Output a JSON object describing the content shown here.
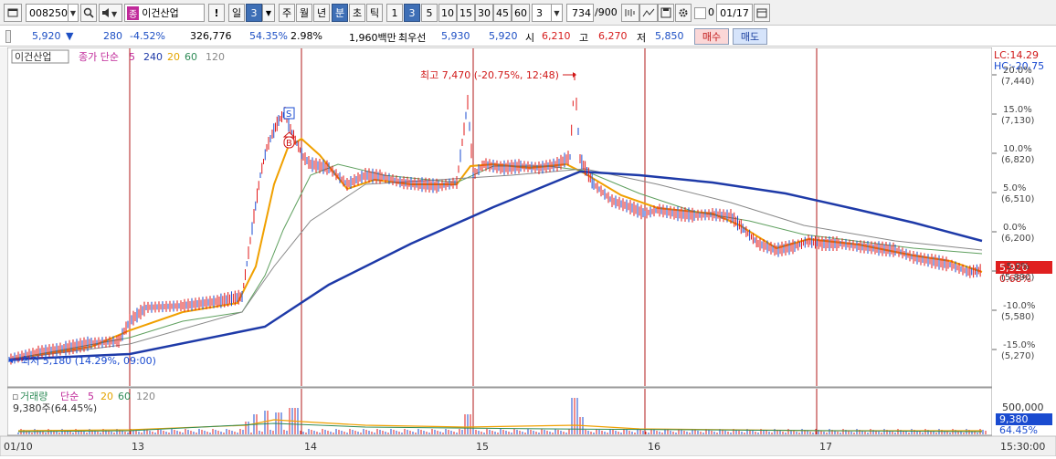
{
  "toolbar": {
    "code": "008250",
    "stock_badge": "종",
    "stock_name": "이건산업",
    "alert_label": "!",
    "period_daily": "일",
    "period_daily_value": "3",
    "period_weekly": "주",
    "period_monthly": "월",
    "period_yearly": "년",
    "period_minute": "분",
    "period_second": "초",
    "period_tick": "틱",
    "intervals": [
      "1",
      "3",
      "5",
      "10",
      "15",
      "30",
      "45",
      "60"
    ],
    "interval_active": "3",
    "interval_select": "3",
    "count_value": "734",
    "count_total": "/900",
    "zero_label": "0",
    "date_value": "01/17"
  },
  "quote": {
    "price": "5,920",
    "change": "280",
    "change_pct": "-4.52%",
    "volume": "326,776",
    "volume_ratio": "54.35%",
    "turnover_pct": "2.98%",
    "amount": "1,960백만",
    "best_ask_label": "최우선",
    "best_ask": "5,930",
    "best_bid": "5,920",
    "open_label": "시",
    "open": "6,210",
    "high_label": "고",
    "high": "6,270",
    "low_label": "저",
    "low": "5,850",
    "buy_label": "매수",
    "sell_label": "매도"
  },
  "price_panel": {
    "legend_name": "이건산업",
    "legend_indicator": "종가 단순",
    "ma_periods": [
      "5",
      "240",
      "20",
      "60",
      "120"
    ],
    "lc_label": "LC:14.29",
    "hc_label": "HC:-20.75",
    "high_annotation": "최고 7,470 (-20.75%, 12:48)",
    "low_annotation": "최저 5,180 (14.29%, 09:00)",
    "signal_sell": "S",
    "signal_buy": "B",
    "current_price_tag": "5,920",
    "current_pct_tag": "0.68%",
    "y_ticks": [
      {
        "pct": "20.0%",
        "price": "(7,440)"
      },
      {
        "pct": "15.0%",
        "price": "(7,130)"
      },
      {
        "pct": "10.0%",
        "price": "(6,820)"
      },
      {
        "pct": "5.0%",
        "price": "(6,510)"
      },
      {
        "pct": "0.0%",
        "price": "(6,200)"
      },
      {
        "pct": "-5.0%",
        "price": "(5,890)"
      },
      {
        "pct": "-10.0%",
        "price": "(5,580)"
      },
      {
        "pct": "-15.0%",
        "price": "(5,270)"
      }
    ]
  },
  "volume_panel": {
    "legend_name": "거래량",
    "legend_indicator": "단순",
    "ma_periods": [
      "5",
      "20",
      "60",
      "120"
    ],
    "current_volume": "9,380주(64.45%)",
    "y_tick": "500,000",
    "volume_tag": "9,380",
    "volume_pct_tag": "64.45%"
  },
  "x_axis": {
    "labels": [
      "01/10",
      "13",
      "14",
      "15",
      "16",
      "17"
    ],
    "time_label": "15:30:00"
  },
  "colors": {
    "price_line": "#e21a1a",
    "ma5": "#f0a000",
    "ma20": "#5fa05f",
    "ma60": "#2e8b57",
    "ma120": "#888888",
    "ma240": "#1e3aa8",
    "day_separator": "#b01818",
    "tag_red": "#e02020",
    "tag_blue": "#1a4bd0"
  }
}
